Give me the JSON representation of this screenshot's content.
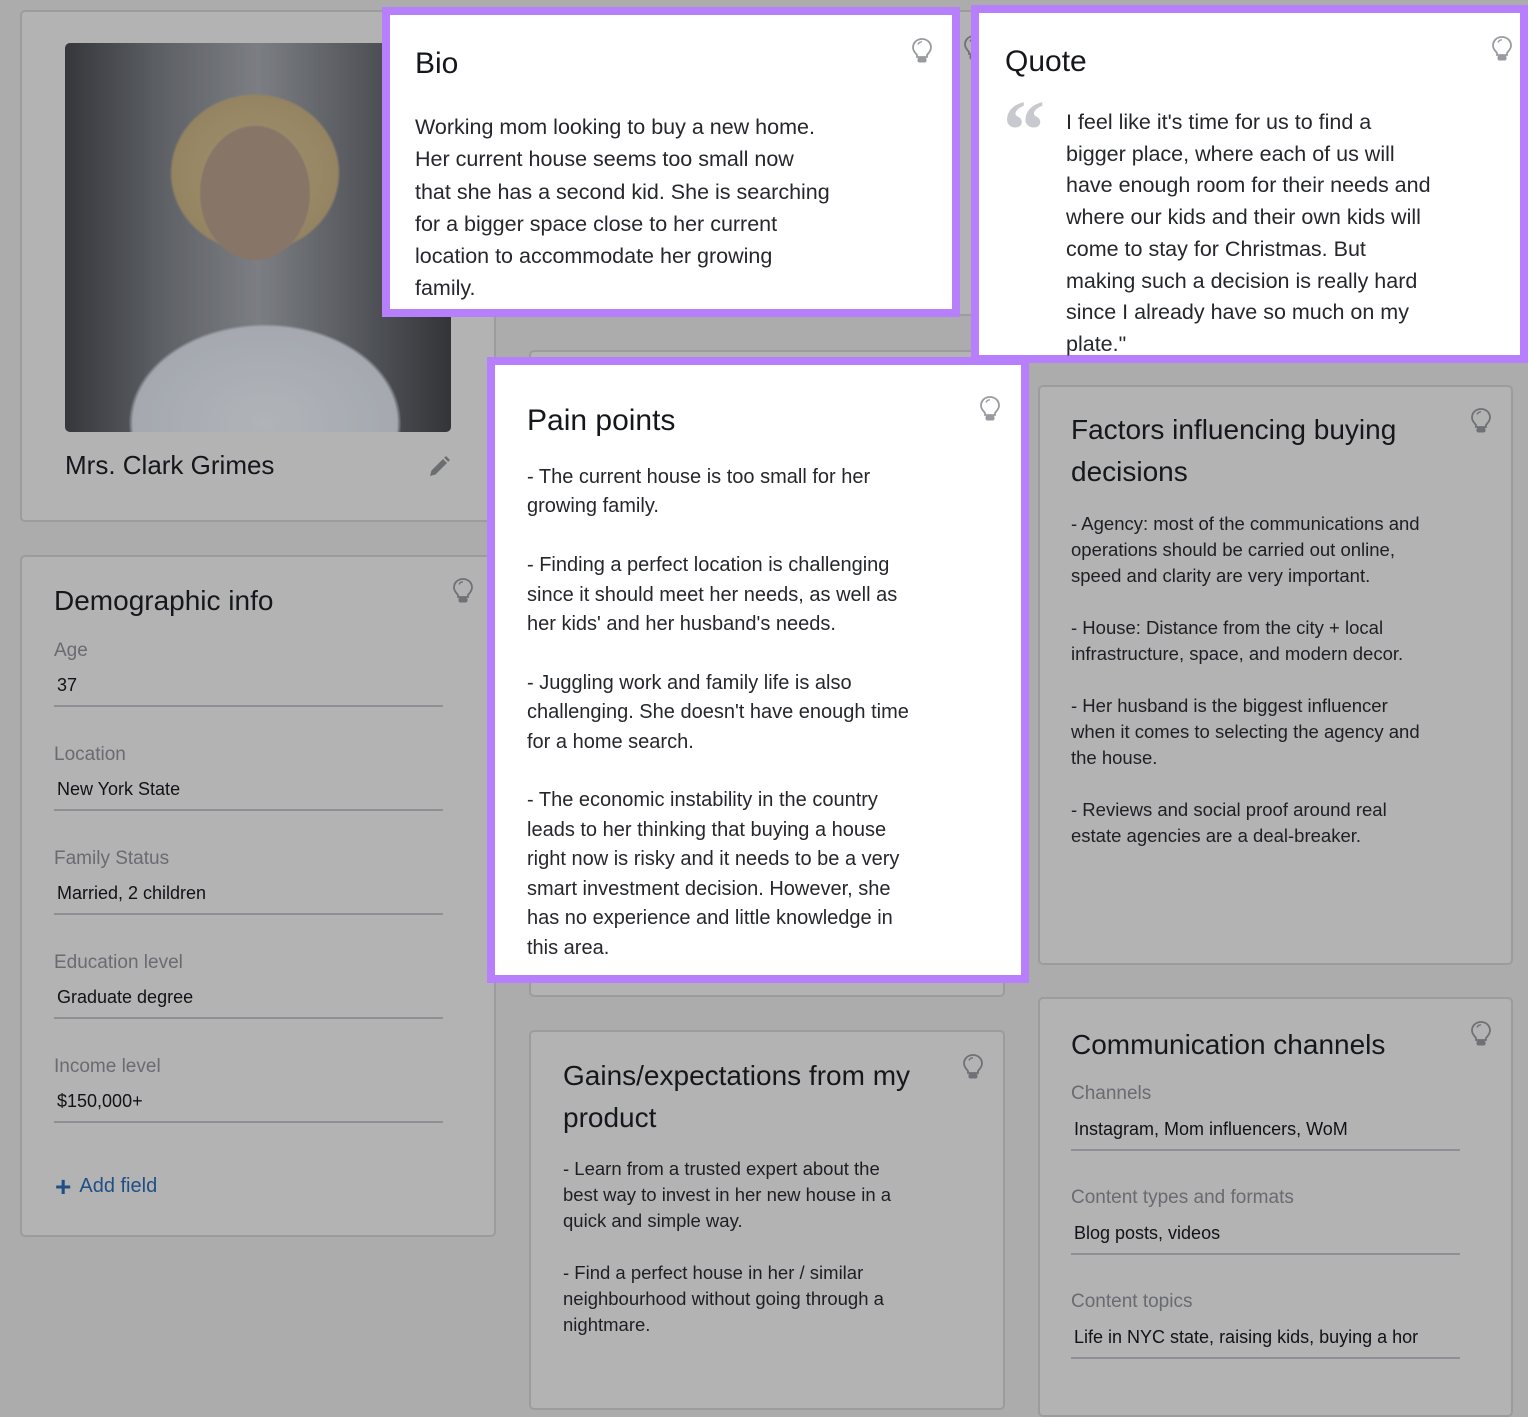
{
  "profile": {
    "name": "Mrs. Clark Grimes",
    "photo_icon": "persona-photo",
    "edit_icon": "pencil-icon"
  },
  "bio": {
    "title": "Bio",
    "text": "Working mom looking to buy a new home.\nHer current house seems too small now\nthat she has a second kid. She is searching\nfor a bigger space close to her current\nlocation to accommodate her growing\nfamily."
  },
  "quote": {
    "title": "Quote",
    "quote_mark": "“",
    "text": "I feel like it's time for us to find a\nbigger place, where each of us will\nhave enough room for their needs and\nwhere our kids and their own kids will\ncome to stay for Christmas. But\nmaking such a decision is really hard\nsince I already have so much on my\nplate.\""
  },
  "demographic": {
    "title": "Demographic info",
    "fields": [
      {
        "label": "Age",
        "value": "37"
      },
      {
        "label": "Location",
        "value": "New York State"
      },
      {
        "label": "Family Status",
        "value": "Married, 2 children"
      },
      {
        "label": "Education level",
        "value": "Graduate degree"
      },
      {
        "label": "Income level",
        "value": "$150,000+"
      }
    ],
    "add_field_label": "Add field",
    "add_icon": "+"
  },
  "pain_points": {
    "title": "Pain points",
    "text": "- The current house is too small for her\ngrowing family.\n\n- Finding a perfect location is challenging\nsince it should meet her needs, as well as\nher kids' and her husband's needs.\n\n- Juggling work and family life is also\nchallenging. She doesn't have enough time\nfor a home search.\n\n- The economic instability in the country\nleads to her thinking that buying a house\nright now is risky and it needs to be a very\nsmart investment decision. However, she\nhas no experience and little knowledge in\nthis area."
  },
  "factors": {
    "title": "Factors influencing buying decisions",
    "text": "- Agency: most of the communications and\noperations should be carried out online,\nspeed and clarity are very important.\n\n- House: Distance from the city + local\ninfrastructure, space, and modern decor.\n\n- Her husband is the biggest influencer\nwhen it comes to selecting the agency and\nthe house.\n\n- Reviews and social proof around real\nestate agencies are a deal-breaker."
  },
  "gains": {
    "title": "Gains/expectations from my product",
    "text": "- Learn from a trusted expert about the\nbest way to invest in her new house in a\nquick and simple way.\n\n- Find a perfect house in her / similar\nneighbourhood without going through a\nnightmare."
  },
  "communication": {
    "title": "Communication channels",
    "fields": [
      {
        "label": "Channels",
        "value": "Instagram, Mom influencers, WoM"
      },
      {
        "label": "Content types and formats",
        "value": "Blog posts, videos"
      },
      {
        "label": "Content topics",
        "value": "Life in NYC state, raising kids, buying a hor"
      }
    ]
  },
  "colors": {
    "highlight": "#b77ffb",
    "overlay_bg": "#acacac",
    "link": "#1f4f86"
  }
}
